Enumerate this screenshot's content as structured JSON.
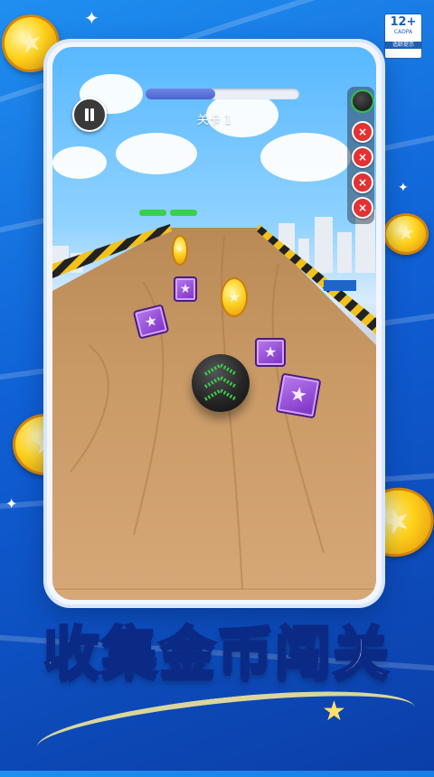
{
  "hud": {
    "level_label": "关卡 1",
    "progress": 0.45,
    "lives": [
      "×",
      "×",
      "×",
      "×"
    ]
  },
  "rating_badge": {
    "age": "12+",
    "org": "CADPA",
    "hint": "适龄提示"
  },
  "slogan": {
    "part1": "收集",
    "part2": "金币闯关"
  },
  "colors": {
    "background": "#1569dc",
    "progress_fill": "#5a72d8",
    "life_icon": "#e23232",
    "slogan_yellow": "#ffe21f",
    "slogan_stroke": "#0b2a86",
    "box_purple": "#8f3fd6",
    "coin_gold": "#ffd224",
    "ball_green": "#39d14a"
  },
  "icons": {
    "pause": "pause-icon",
    "life": "x-circle-icon",
    "coin": "star-coin-icon",
    "box": "star-crate-icon"
  }
}
